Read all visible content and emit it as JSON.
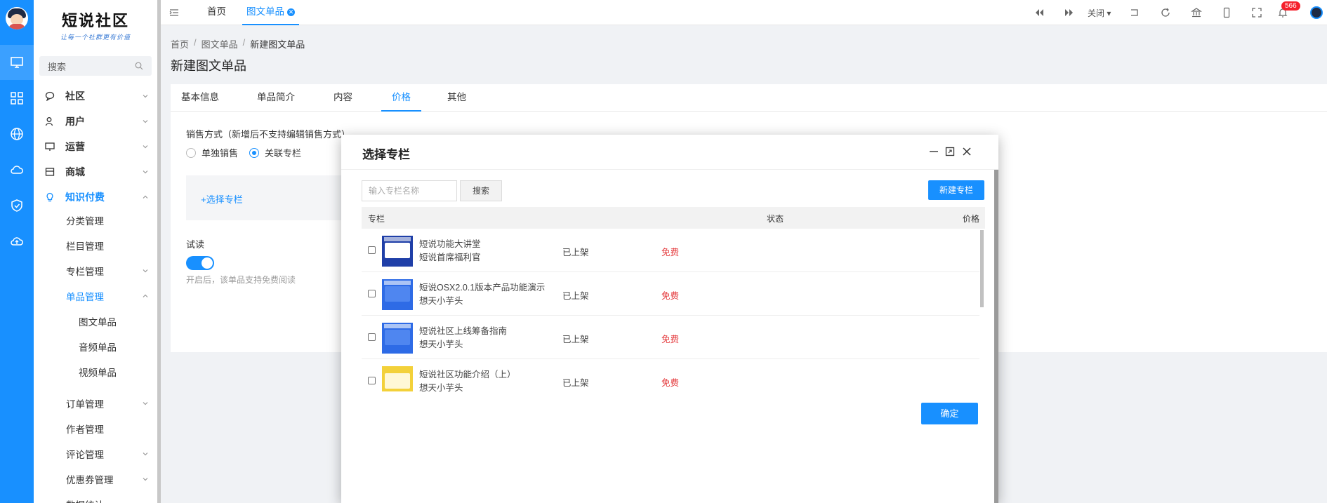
{
  "brand": {
    "name": "短说社区",
    "slogan": "让每一个社群更有价值"
  },
  "sidebar": {
    "search_label": "搜索",
    "menu": [
      {
        "label": "社区"
      },
      {
        "label": "用户"
      },
      {
        "label": "运营"
      },
      {
        "label": "商城"
      },
      {
        "label": "知识付费"
      }
    ],
    "sub": [
      {
        "label": "分类管理"
      },
      {
        "label": "栏目管理"
      },
      {
        "label": "专栏管理"
      },
      {
        "label": "单品管理"
      },
      {
        "label": "图文单品"
      },
      {
        "label": "音频单品"
      },
      {
        "label": "视频单品"
      },
      {
        "label": "订单管理"
      },
      {
        "label": "作者管理"
      },
      {
        "label": "评论管理"
      },
      {
        "label": "优惠券管理"
      },
      {
        "label": "数据统计"
      }
    ]
  },
  "topbar": {
    "tabs": [
      {
        "label": "首页"
      },
      {
        "label": "图文单品"
      }
    ],
    "close_label": "关闭",
    "notification_count": "566"
  },
  "breadcrumb": [
    "首页",
    "图文单品",
    "新建图文单品"
  ],
  "page_title": "新建图文单品",
  "form_tabs": [
    "基本信息",
    "单品简介",
    "内容",
    "价格",
    "其他"
  ],
  "form": {
    "sale_mode_label": "销售方式（新增后不支持编辑销售方式）",
    "option_single": "单独销售",
    "option_column": "关联专栏",
    "select_column_link": "+选择专栏",
    "trial_label": "试读",
    "trial_enabled": true,
    "trial_hint": "开启后，该单品支持免费阅读"
  },
  "dialog": {
    "title": "选择专栏",
    "search_placeholder": "输入专栏名称",
    "search_button": "搜索",
    "new_button": "新建专栏",
    "columns": [
      "专栏",
      "状态",
      "价格"
    ],
    "rows": [
      {
        "title": "短说功能大讲堂",
        "author": "短说首席福利官",
        "status": "已上架",
        "price": "免费"
      },
      {
        "title": "短说OSX2.0.1版本产品功能演示",
        "author": "想天小芋头",
        "status": "已上架",
        "price": "免费"
      },
      {
        "title": "短说社区上线筹备指南",
        "author": "想天小芋头",
        "status": "已上架",
        "price": "免费"
      },
      {
        "title": "短说社区功能介绍（上）",
        "author": "想天小芋头",
        "status": "已上架",
        "price": "免费"
      }
    ],
    "confirm_button": "确定"
  },
  "colors": {
    "primary": "#1890ff",
    "danger": "#e4393c"
  }
}
